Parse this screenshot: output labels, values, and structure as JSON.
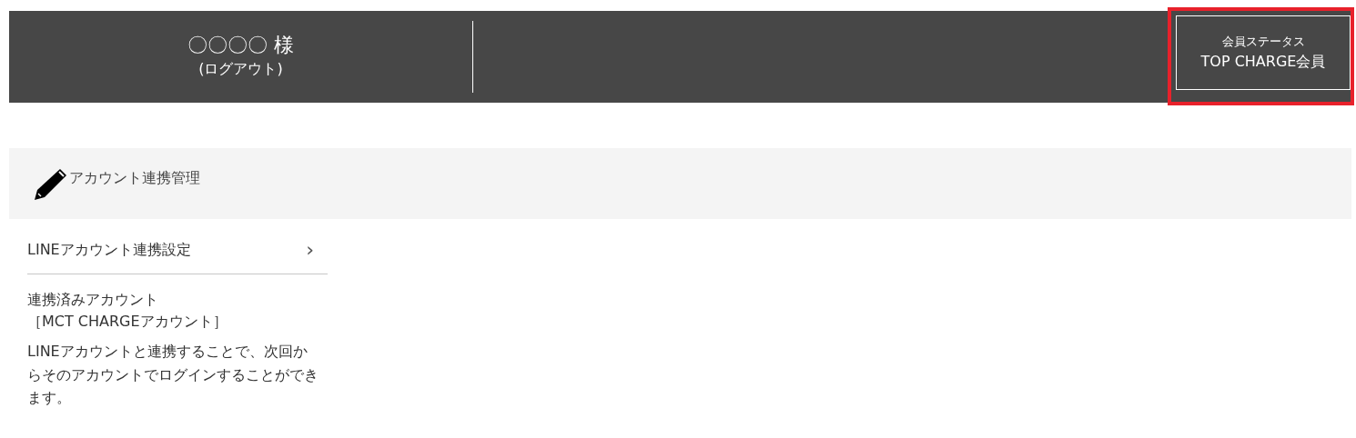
{
  "header": {
    "user_name": "〇〇〇〇 様",
    "logout_link": "(ログアウト)",
    "member_status": {
      "label": "会員ステータス",
      "value": "TOP CHARGE会員",
      "highlighted": true
    }
  },
  "section": {
    "title": "アカウント連携管理"
  },
  "link_settings": {
    "label": "LINEアカウント連携設定",
    "chevron": "›"
  },
  "linked_account": {
    "label": "連携済みアカウント",
    "value": "［MCT CHARGEアカウント］"
  },
  "description": "LINEアカウントと連携することで、次回からそのアカウントでログインすることができます。"
}
